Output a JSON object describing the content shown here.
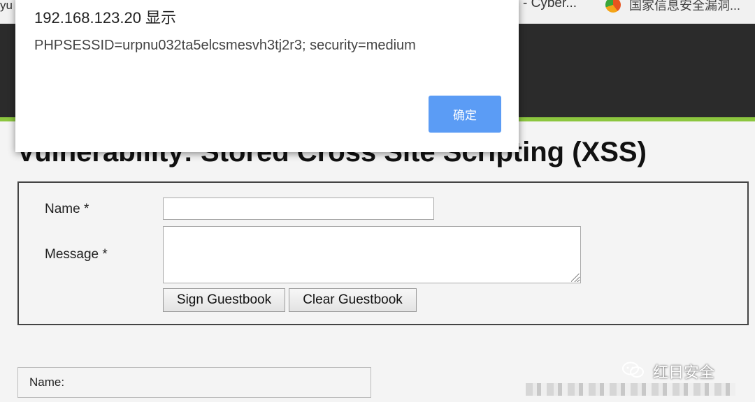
{
  "browser": {
    "bookmarks": [
      {
        "label": "yu",
        "icon": "bookmark-icon"
      },
      {
        "label": "- Cyber...",
        "icon": "bookmark-icon"
      },
      {
        "label": "国家信息安全漏洞...",
        "icon": "cnnvd-icon"
      }
    ]
  },
  "page": {
    "title": "Vulnerability: Stored Cross Site Scripting (XSS)"
  },
  "form": {
    "name_label": "Name *",
    "message_label": "Message *",
    "name_value": "",
    "message_value": "",
    "sign_button": "Sign Guestbook",
    "clear_button": "Clear Guestbook"
  },
  "guestbook": {
    "entry_name_label": "Name:"
  },
  "alert": {
    "title": "192.168.123.20 显示",
    "message": "PHPSESSID=urpnu032ta5elcsmesvh3tj2r3; security=medium",
    "ok_label": "确定",
    "accent": "#5b9cf5"
  },
  "watermark": {
    "text": "红日安全",
    "icon": "wechat-icon"
  },
  "colors": {
    "header": "#2b2b2b",
    "accent_bar": "#8cc63f"
  }
}
